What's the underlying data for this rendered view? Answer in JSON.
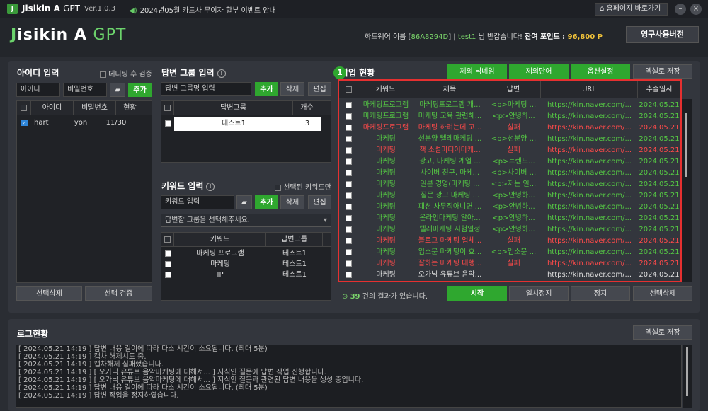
{
  "titlebar": {
    "title_a": "Jisikin A",
    "title_b": "GPT",
    "version": "Ver.1.0.3",
    "notice": "2024년05월 카드사 무이자 할부 이벤트 안내",
    "home_button": "홈페이지 바로가기",
    "min": "–",
    "close": "×"
  },
  "header": {
    "brand_j": "J",
    "brand_rest": "isikin A ",
    "brand_gpt": "GPT",
    "hw_label": "하드웨어 이름 [",
    "hw_id": "86A8294D",
    "hw_close": "]",
    "sep": " | ",
    "user": "test1",
    "greeting": " 님 반갑습니다! ",
    "points_label": "잔여 포인트 : ",
    "points": "96,800 P",
    "permanent_button": "영구사용버전"
  },
  "id_panel": {
    "title": "아이디 입력",
    "debug_label": "데디팅 후 검증",
    "id_placeholder": "아이디",
    "pw_placeholder": "비밀번호",
    "add": "추가",
    "columns": [
      "",
      "아이디",
      "비밀번호",
      "현황"
    ],
    "rows": [
      {
        "id": "hart",
        "pw": "yon",
        "status": "11/30"
      }
    ],
    "delete_button": "선택삭제",
    "verify_button": "선택 검증"
  },
  "answer_group": {
    "title": "답변 그룹 입력",
    "placeholder": "답변 그룹명 입력",
    "add": "추가",
    "delete": "삭제",
    "edit": "편집",
    "columns": [
      "",
      "답변그룹",
      "개수"
    ],
    "rows": [
      {
        "name": "테스트1",
        "count": "3"
      }
    ]
  },
  "keyword_panel": {
    "title": "키워드 입력",
    "only_selected": "선택된 키워드만",
    "placeholder": "키워드 입력",
    "add": "추가",
    "delete": "삭제",
    "edit": "편집",
    "select_prompt": "답변할 그룹을 선택해주세요.",
    "columns": [
      "",
      "키워드",
      "답변그룹"
    ],
    "rows": [
      {
        "kw": "마케팅 프로그램",
        "group": "테스트1"
      },
      {
        "kw": "마케팅",
        "group": "테스트1"
      },
      {
        "kw": "IP",
        "group": "테스트1"
      }
    ]
  },
  "job": {
    "title": "작업 현황",
    "badge": "1",
    "buttons": {
      "exclude_nick": "제외 닉네임",
      "exclude_word": "제외단어",
      "options": "옵션설정",
      "excel": "엑셀로 저장"
    },
    "columns": [
      "",
      "키워드",
      "제목",
      "답변",
      "URL",
      "추출일시"
    ],
    "rows": [
      {
        "kw": "마케팅프로그램",
        "title": "마케팅프로그램 개...",
        "ans": "<p>마케팅 ...",
        "url": "https://kin.naver.com/...",
        "date": "2024.05.21",
        "color": "green"
      },
      {
        "kw": "마케팅프로그램",
        "title": "마케팅 교육 관련해...",
        "ans": "<p>안녕하...",
        "url": "https://kin.naver.com/...",
        "date": "2024.05.21",
        "color": "green"
      },
      {
        "kw": "마케팅프로그램",
        "title": "마케팅 하려는데 고...",
        "ans": "실패",
        "url": "https://kin.naver.com/...",
        "date": "2024.05.21",
        "color": "red"
      },
      {
        "kw": "마케팅",
        "title": "선분양 텔레마케팅 ...",
        "ans": "<p>선분양 ...",
        "url": "https://kin.naver.com/...",
        "date": "2024.05.21",
        "color": "green"
      },
      {
        "kw": "마케팅",
        "title": "책 소설미디어마케...",
        "ans": "실패",
        "url": "https://kin.naver.com/...",
        "date": "2024.05.21",
        "color": "red"
      },
      {
        "kw": "마케팅",
        "title": "광고, 마케팅 계열 ...",
        "ans": "<p>트렌드...",
        "url": "https://kin.naver.com/...",
        "date": "2024.05.21",
        "color": "green"
      },
      {
        "kw": "마케팅",
        "title": "사이버 친구, 마케...",
        "ans": "<p>사이버 ...",
        "url": "https://kin.naver.com/...",
        "date": "2024.05.21",
        "color": "green"
      },
      {
        "kw": "마케팅",
        "title": "일본 경영(마케팅 ...",
        "ans": "<p>저는 일...",
        "url": "https://kin.naver.com/...",
        "date": "2024.05.21",
        "color": "green"
      },
      {
        "kw": "마케팅",
        "title": "질문 광고 마케팅 ...",
        "ans": "<p>안녕하...",
        "url": "https://kin.naver.com/...",
        "date": "2024.05.21",
        "color": "green"
      },
      {
        "kw": "마케팅",
        "title": "패션 사무직아니면 ...",
        "ans": "<p>안녕하...",
        "url": "https://kin.naver.com/...",
        "date": "2024.05.21",
        "color": "green"
      },
      {
        "kw": "마케팅",
        "title": "온라인마케팅 알아...",
        "ans": "<p>안녕하...",
        "url": "https://kin.naver.com/...",
        "date": "2024.05.21",
        "color": "green"
      },
      {
        "kw": "마케팅",
        "title": "텔레마케팅 시험일정",
        "ans": "<p>안녕하...",
        "url": "https://kin.naver.com/...",
        "date": "2024.05.21",
        "color": "green"
      },
      {
        "kw": "마케팅",
        "title": "블로그 마케팅 업체...",
        "ans": "실패",
        "url": "https://kin.naver.com/...",
        "date": "2024.05.21",
        "color": "red"
      },
      {
        "kw": "마케팅",
        "title": "입소문 마케팅이 효...",
        "ans": "<p>입소문 ...",
        "url": "https://kin.naver.com/...",
        "date": "2024.05.21",
        "color": "green"
      },
      {
        "kw": "마케팅",
        "title": "잘하는 마케팅 대행...",
        "ans": "실패",
        "url": "https://kin.naver.com/...",
        "date": "2024.05.21",
        "color": "red"
      },
      {
        "kw": "마케팅",
        "title": "오가닉 유튜브 음악...",
        "ans": "",
        "url": "https://kin.naver.com/...",
        "date": "2024.05.21",
        "color": "white"
      }
    ],
    "result_count": "39",
    "result_text": " 건의 결과가 있습니다.",
    "start": "시작",
    "pause": "일시정지",
    "stop": "정지",
    "delete_selected": "선택삭제"
  },
  "log": {
    "title": "로그현황",
    "excel": "엑셀로 저장",
    "lines": [
      "[ 2024.05.21 14:19 ] 답변 내용 길이에 따라 다소 시간이 소요됩니다. (최대 5분)",
      "[ 2024.05.21 14:19 ] 캡차 해제시도 중.",
      "[ 2024.05.21 14:19 ] 캡차해제 실패했습니다.",
      "[ 2024.05.21 14:19 ] [ 오가닉 유튜브 음악마케팅에 대해서... ] 지식인 질문에 답변 작업 진행합니다.",
      "[ 2024.05.21 14:19 ] [ 오가닉 유튜브 음악마케팅에 대해서... ] 지식인 질문과 관련된 답변 내용을 생성 중입니다.",
      "[ 2024.05.21 14:19 ] 답변 내용 길이에 따라 다소 시간이 소요됩니다. (최대 5분)",
      "[ 2024.05.21 14:19 ] 답변 작업을 정지하였습니다."
    ]
  },
  "colors": {
    "accent_green": "#2fa72f",
    "fail_red": "#ff4a4a",
    "ok_green": "#55c944",
    "highlight_border": "#e53030"
  }
}
